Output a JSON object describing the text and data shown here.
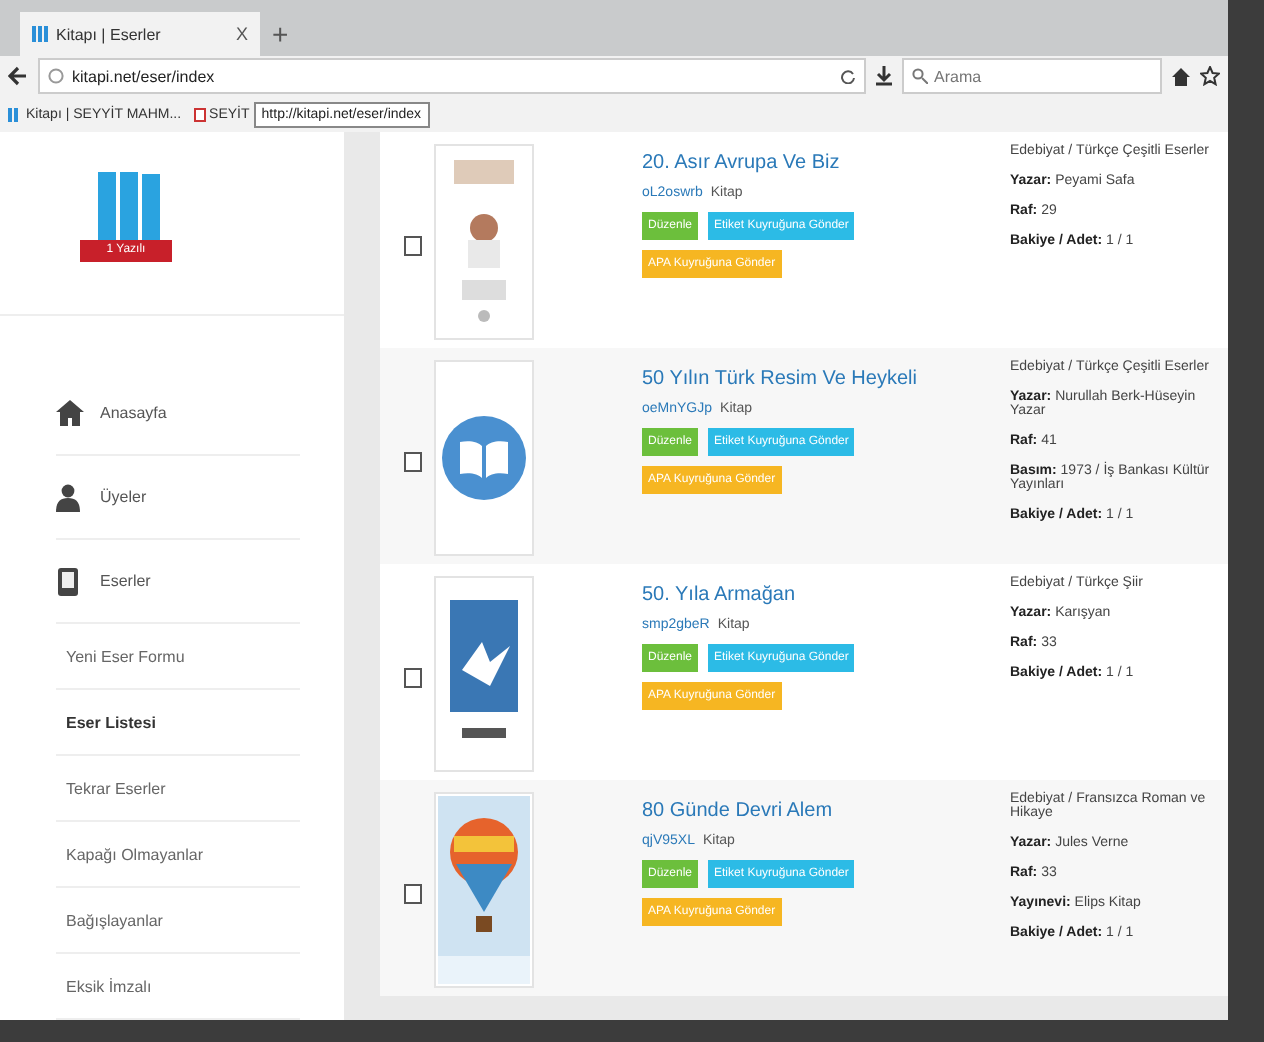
{
  "browser": {
    "tab": {
      "title": "Kitapı | Eserler",
      "close": "X",
      "new_tab": "+"
    },
    "url": "kitapi.net/eser/index",
    "search": {
      "placeholder": "Arama"
    },
    "bookmarks": [
      {
        "label": "Kitapı | SEYYİT MAHM..."
      },
      {
        "label": "SEYİT"
      }
    ],
    "tooltip": "http://kitapi.net/eser/index"
  },
  "sidebar": {
    "logo_ribbon": "1 Yazılı",
    "items": [
      {
        "label": "Anasayfa",
        "kind": "home"
      },
      {
        "label": "Üyeler",
        "kind": "user"
      },
      {
        "label": "Eserler",
        "kind": "book",
        "children": [
          {
            "label": "Yeni Eser Formu",
            "selected": false
          },
          {
            "label": "Eser Listesi",
            "selected": true
          },
          {
            "label": "Tekrar Eserler",
            "selected": false
          },
          {
            "label": "Kapağı Olmayanlar",
            "selected": false
          },
          {
            "label": "Bağışlayanlar",
            "selected": false
          },
          {
            "label": "Eksik İmzalı",
            "selected": false
          }
        ]
      }
    ]
  },
  "works": [
    {
      "title": "20. Asır Avrupa Ve Biz",
      "code": "oL2oswrb",
      "type": "Kitap",
      "kind": "picture",
      "checked": false,
      "category": "Edebiyat / Türkçe Çeşitli Eserler",
      "details": [
        {
          "label": "Yazar:",
          "value": "Peyami Safa"
        },
        {
          "label": "Raf:",
          "value": "29"
        },
        {
          "label": "Bakiye / Adet:",
          "value": "1 / 1"
        }
      ],
      "buttons": [
        {
          "label": "Düzenle",
          "kind": "edit"
        },
        {
          "label": "Etiket Kuyruğuna Gönder",
          "kind": "label"
        },
        {
          "label": "APA Kuyruğuna Gönder",
          "kind": "apa"
        }
      ]
    },
    {
      "title": "50 Yılın Türk Resim Ve Heykeli",
      "code": "oeMnYGJp",
      "type": "Kitap",
      "kind": "icon",
      "checked": false,
      "category": "Edebiyat / Türkçe Çeşitli Eserler",
      "details": [
        {
          "label": "Yazar:",
          "value": "Nurullah Berk-Hüseyin Yazar"
        },
        {
          "label": "Raf:",
          "value": "41"
        },
        {
          "label": "Basım:",
          "value": "1973 / İş Bankası Kültür Yayınları"
        },
        {
          "label": "Bakiye / Adet:",
          "value": "1 / 1"
        }
      ],
      "buttons": [
        {
          "label": "Düzenle",
          "kind": "edit"
        },
        {
          "label": "Etiket Kuyruğuna Gönder",
          "kind": "label"
        },
        {
          "label": "APA Kuyruğuna Gönder",
          "kind": "apa"
        }
      ]
    },
    {
      "title": "50. Yıla Armağan",
      "code": "smp2gbeR",
      "type": "Kitap",
      "kind": "picture",
      "checked": false,
      "category": "Edebiyat / Türkçe Şiir",
      "details": [
        {
          "label": "Yazar:",
          "value": "Karışyan"
        },
        {
          "label": "Raf:",
          "value": "33"
        },
        {
          "label": "Bakiye / Adet:",
          "value": "1 / 1"
        }
      ],
      "buttons": [
        {
          "label": "Düzenle",
          "kind": "edit"
        },
        {
          "label": "Etiket Kuyruğuna Gönder",
          "kind": "label"
        },
        {
          "label": "APA Kuyruğuna Gönder",
          "kind": "apa"
        }
      ]
    },
    {
      "title": "80 Günde Devri Alem",
      "code": "qjV95XL",
      "type": "Kitap",
      "kind": "picture",
      "checked": false,
      "category": "Edebiyat / Fransızca Roman ve Hikaye",
      "details": [
        {
          "label": "Yazar:",
          "value": "Jules Verne"
        },
        {
          "label": "Raf:",
          "value": "33"
        },
        {
          "label": "Yayınevi:",
          "value": "Elips Kitap"
        },
        {
          "label": "Bakiye / Adet:",
          "value": "1 / 1"
        }
      ],
      "buttons": [
        {
          "label": "Düzenle",
          "kind": "edit"
        },
        {
          "label": "Etiket Kuyruğuna Gönder",
          "kind": "label"
        },
        {
          "label": "APA Kuyruğuna Gönder",
          "kind": "apa"
        }
      ]
    }
  ]
}
